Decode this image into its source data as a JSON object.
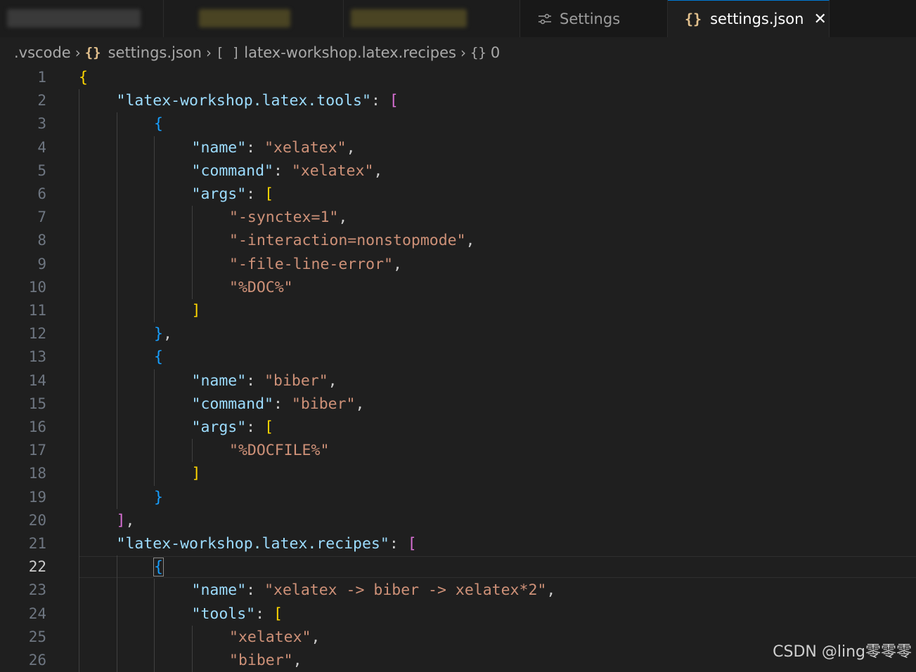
{
  "tabs": [
    {
      "label": "Settings",
      "icon": "settings-sliders-icon",
      "active": false
    },
    {
      "label": "settings.json",
      "icon": "json-braces-icon",
      "active": true
    }
  ],
  "breadcrumb": [
    {
      "label": ".vscode",
      "icon": ""
    },
    {
      "label": "settings.json",
      "icon": "{}"
    },
    {
      "label": "latex-workshop.latex.recipes",
      "icon": "[ ]"
    },
    {
      "label": "0",
      "icon": "{}"
    }
  ],
  "editor": {
    "current_line": 22,
    "lines": [
      {
        "n": "1",
        "indent": 0,
        "tokens": [
          [
            "{",
            "b1"
          ]
        ]
      },
      {
        "n": "2",
        "indent": 1,
        "tokens": [
          [
            "\"latex-workshop.latex.tools\"",
            "k"
          ],
          [
            ": ",
            "p"
          ],
          [
            "[",
            "b2"
          ]
        ]
      },
      {
        "n": "3",
        "indent": 2,
        "tokens": [
          [
            "{",
            "b3"
          ]
        ]
      },
      {
        "n": "4",
        "indent": 3,
        "tokens": [
          [
            "\"name\"",
            "k"
          ],
          [
            ": ",
            "p"
          ],
          [
            "\"xelatex\"",
            "s"
          ],
          [
            ",",
            "p"
          ]
        ]
      },
      {
        "n": "5",
        "indent": 3,
        "tokens": [
          [
            "\"command\"",
            "k"
          ],
          [
            ": ",
            "p"
          ],
          [
            "\"xelatex\"",
            "s"
          ],
          [
            ",",
            "p"
          ]
        ]
      },
      {
        "n": "6",
        "indent": 3,
        "tokens": [
          [
            "\"args\"",
            "k"
          ],
          [
            ": ",
            "p"
          ],
          [
            "[",
            "b1"
          ]
        ]
      },
      {
        "n": "7",
        "indent": 4,
        "tokens": [
          [
            "\"-synctex=1\"",
            "s"
          ],
          [
            ",",
            "p"
          ]
        ]
      },
      {
        "n": "8",
        "indent": 4,
        "tokens": [
          [
            "\"-interaction=nonstopmode\"",
            "s"
          ],
          [
            ",",
            "p"
          ]
        ]
      },
      {
        "n": "9",
        "indent": 4,
        "tokens": [
          [
            "\"-file-line-error\"",
            "s"
          ],
          [
            ",",
            "p"
          ]
        ]
      },
      {
        "n": "10",
        "indent": 4,
        "tokens": [
          [
            "\"%DOC%\"",
            "s"
          ]
        ]
      },
      {
        "n": "11",
        "indent": 3,
        "tokens": [
          [
            "]",
            "b1"
          ]
        ]
      },
      {
        "n": "12",
        "indent": 2,
        "tokens": [
          [
            "}",
            "b3"
          ],
          [
            ",",
            "p"
          ]
        ]
      },
      {
        "n": "13",
        "indent": 2,
        "tokens": [
          [
            "{",
            "b3"
          ]
        ]
      },
      {
        "n": "14",
        "indent": 3,
        "tokens": [
          [
            "\"name\"",
            "k"
          ],
          [
            ": ",
            "p"
          ],
          [
            "\"biber\"",
            "s"
          ],
          [
            ",",
            "p"
          ]
        ]
      },
      {
        "n": "15",
        "indent": 3,
        "tokens": [
          [
            "\"command\"",
            "k"
          ],
          [
            ": ",
            "p"
          ],
          [
            "\"biber\"",
            "s"
          ],
          [
            ",",
            "p"
          ]
        ]
      },
      {
        "n": "16",
        "indent": 3,
        "tokens": [
          [
            "\"args\"",
            "k"
          ],
          [
            ": ",
            "p"
          ],
          [
            "[",
            "b1"
          ]
        ]
      },
      {
        "n": "17",
        "indent": 4,
        "tokens": [
          [
            "\"%DOCFILE%\"",
            "s"
          ]
        ]
      },
      {
        "n": "18",
        "indent": 3,
        "tokens": [
          [
            "]",
            "b1"
          ]
        ]
      },
      {
        "n": "19",
        "indent": 2,
        "tokens": [
          [
            "}",
            "b3"
          ]
        ]
      },
      {
        "n": "20",
        "indent": 1,
        "tokens": [
          [
            "]",
            "b2"
          ],
          [
            ",",
            "p"
          ]
        ]
      },
      {
        "n": "21",
        "indent": 1,
        "tokens": [
          [
            "\"latex-workshop.latex.recipes\"",
            "k"
          ],
          [
            ": ",
            "p"
          ],
          [
            "[",
            "b2"
          ]
        ]
      },
      {
        "n": "22",
        "indent": 2,
        "tokens": [
          [
            "{",
            "b3"
          ]
        ]
      },
      {
        "n": "23",
        "indent": 3,
        "tokens": [
          [
            "\"name\"",
            "k"
          ],
          [
            ": ",
            "p"
          ],
          [
            "\"xelatex -> biber -> xelatex*2\"",
            "s"
          ],
          [
            ",",
            "p"
          ]
        ]
      },
      {
        "n": "24",
        "indent": 3,
        "tokens": [
          [
            "\"tools\"",
            "k"
          ],
          [
            ": ",
            "p"
          ],
          [
            "[",
            "b1"
          ]
        ]
      },
      {
        "n": "25",
        "indent": 4,
        "tokens": [
          [
            "\"xelatex\"",
            "s"
          ],
          [
            ",",
            "p"
          ]
        ]
      },
      {
        "n": "26",
        "indent": 4,
        "tokens": [
          [
            "\"biber\"",
            "s"
          ],
          [
            ",",
            "p"
          ]
        ]
      }
    ]
  },
  "watermark": "CSDN @ling零零零",
  "colors": {
    "background": "#1f1f1f",
    "key": "#9cdcfe",
    "string": "#ce9178",
    "bracket_gold": "#ffd700",
    "bracket_orchid": "#da70d6",
    "bracket_blue": "#179fff",
    "tab_active_border": "#0078d4"
  }
}
